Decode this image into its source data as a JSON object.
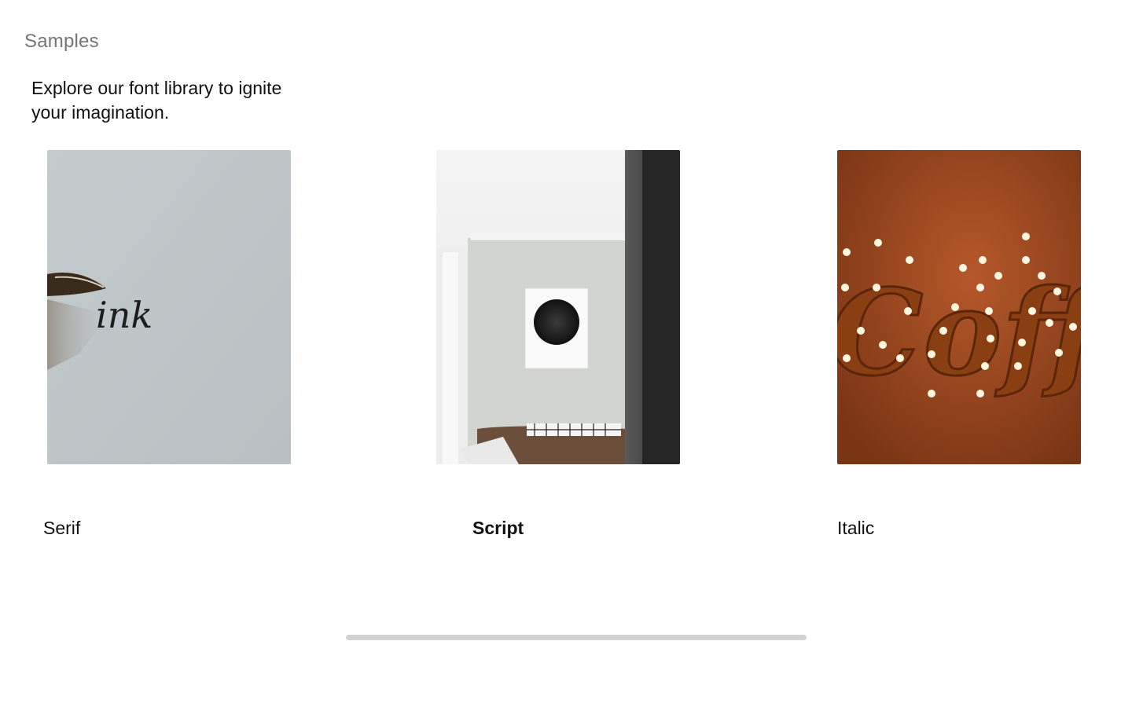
{
  "section": {
    "title": "Samples",
    "intro": "Explore our font library to ignite your imagination."
  },
  "cards": [
    {
      "label": "Serif",
      "image": "pen-writing-ink-photo",
      "selected": false
    },
    {
      "label": "Script",
      "image": "interior-wall-art-photo",
      "selected": true
    },
    {
      "label": "Italic",
      "image": "marquee-lights-coffee-photo",
      "selected": false
    }
  ],
  "photo_text": {
    "ink": "ink",
    "coffee": "Coffee"
  },
  "colors": {
    "title": "#757575",
    "text": "#111111",
    "scrollbar": "#d3d3d3"
  }
}
